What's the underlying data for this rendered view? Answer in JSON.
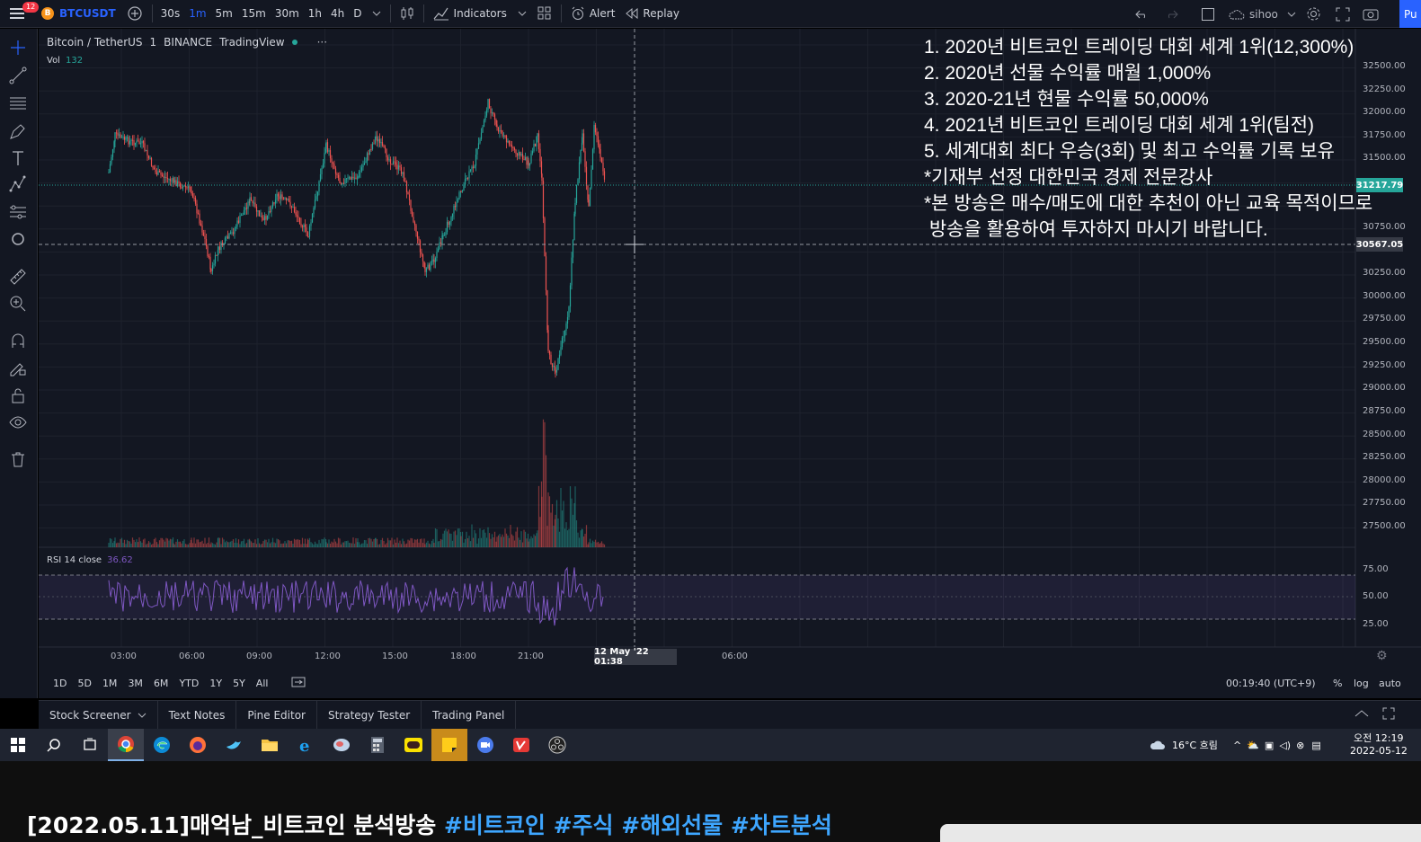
{
  "topbar": {
    "menu_badge": "12",
    "symbol": "BTCUSDT",
    "symbol_icon": "B",
    "intervals": [
      "30s",
      "1m",
      "5m",
      "15m",
      "30m",
      "1h",
      "4h",
      "D"
    ],
    "active_interval": "1m",
    "indicators_label": "Indicators",
    "alert_label": "Alert",
    "replay_label": "Replay",
    "layout_name": "sihoo",
    "publish_label": "Pu"
  },
  "chart": {
    "legend": {
      "title": "Bitcoin / TetherUS",
      "interval": "1",
      "exchange": "BINANCE",
      "source": "TradingView",
      "more": "···"
    },
    "vol_label": "Vol",
    "vol_value": "132",
    "rsi_label": "RSI 14 close",
    "rsi_value": "36.62",
    "price_axis": [
      "32500.00",
      "32250.00",
      "32000.00",
      "31750.00",
      "31500.00",
      "31217.79",
      "30750.00",
      "30567.05",
      "30250.00",
      "30000.00",
      "29750.00",
      "29500.00",
      "29250.00",
      "29000.00",
      "28750.00",
      "28500.00",
      "28250.00",
      "28000.00",
      "27750.00",
      "27500.00"
    ],
    "last_price_tag": "31217.79",
    "cursor_price_tag": "30567.05",
    "rsi_axis": [
      "75.00",
      "50.00",
      "25.00"
    ],
    "time_axis": [
      "03:00",
      "06:00",
      "09:00",
      "12:00",
      "15:00",
      "18:00",
      "21:00",
      "06:00"
    ],
    "cursor_time_tag": "12 May '22  01:38",
    "colors": {
      "up": "#26a69a",
      "down": "#ef5350",
      "rsi": "#7e57c2",
      "bg": "#131722"
    },
    "overlay_lines": [
      "1. 2020년 비트코인 트레이딩 대회 세계 1위(12,300%)",
      "2. 2020년 선물 수익률 매월 1,000%",
      "3. 2020-21년 현물 수익률 50,000%",
      "4. 2021년 비트코인 트레이딩 대회 세계 1위(팀전)",
      "5. 세계대회 최다 우승(3회) 및 최고 수익률 기록 보유",
      "*기재부 선정 대한민국 경제 전문강사",
      "*본 방송은 매수/매도에 대한 추천이 아닌 교육 목적이므로",
      " 방송을 활용하여 투자하지 마시기 바랍니다."
    ]
  },
  "rangebar": {
    "ranges": [
      "1D",
      "5D",
      "1M",
      "3M",
      "6M",
      "YTD",
      "1Y",
      "5Y",
      "All"
    ],
    "clock": "00:19:40 (UTC+9)",
    "percent": "%",
    "log": "log",
    "auto": "auto"
  },
  "bottom_panel": {
    "tabs": [
      "Stock Screener",
      "Text Notes",
      "Pine Editor",
      "Strategy Tester",
      "Trading Panel"
    ]
  },
  "taskbar": {
    "weather": "16°C  흐림",
    "ampm_time": "오전 12:19",
    "date": "2022-05-12"
  },
  "video": {
    "title_plain": "[2022.05.11]매억남_비트코인 분석방송 ",
    "hashtags": "#비트코인 #주식 #해외선물 #차트분석"
  }
}
